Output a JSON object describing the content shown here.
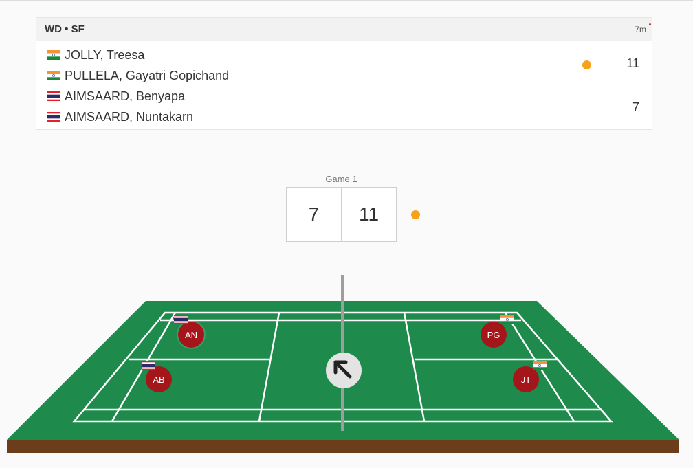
{
  "match": {
    "event": "WD • SF",
    "elapsed": "7m",
    "teams": [
      {
        "players": [
          {
            "name": "JOLLY, Treesa",
            "flag": "india-flag-icon"
          },
          {
            "name": "PULLELA, Gayatri Gopichand",
            "flag": "india-flag-icon"
          }
        ],
        "score": "11",
        "serving": true
      },
      {
        "players": [
          {
            "name": "AIMSAARD, Benyapa",
            "flag": "thailand-flag-icon"
          },
          {
            "name": "AIMSAARD, Nuntakarn",
            "flag": "thailand-flag-icon"
          }
        ],
        "score": "7",
        "serving": false
      }
    ]
  },
  "game": {
    "label": "Game 1",
    "left_score": "7",
    "right_score": "11"
  },
  "court": {
    "players": [
      {
        "initials": "AN",
        "flag": "thailand-flag-icon"
      },
      {
        "initials": "AB",
        "flag": "thailand-flag-icon"
      },
      {
        "initials": "PG",
        "flag": "india-flag-icon"
      },
      {
        "initials": "JT",
        "flag": "india-flag-icon"
      }
    ],
    "shuttle_direction_icon": "arrow-up-left-icon"
  },
  "colors": {
    "serve_indicator": "#f7a21b",
    "court_green": "#1e8a4c",
    "court_base": "#6b3d1a",
    "player_badge": "#a4161a",
    "card_header": "#f2f2f2"
  }
}
